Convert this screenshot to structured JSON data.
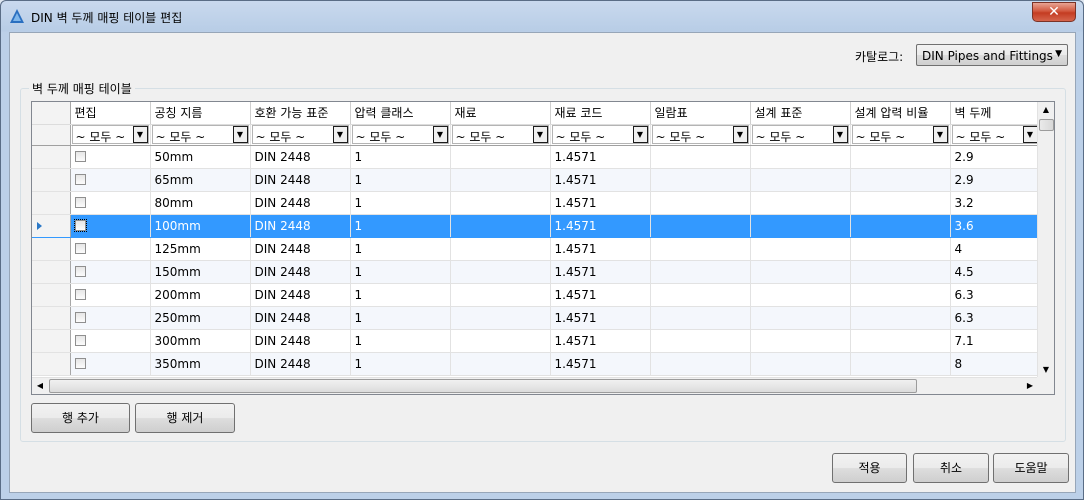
{
  "window": {
    "title": "DIN 벽 두께 매핑 테이블 편집",
    "close_label": "✕"
  },
  "catalog": {
    "label": "카탈로그:",
    "value": "DIN Pipes and Fittings"
  },
  "group": {
    "title": "벽 두께 매핑 테이블"
  },
  "table": {
    "columns": [
      "편집",
      "공칭 지름",
      "호환 가능 표준",
      "압력 클래스",
      "재료",
      "재료 코드",
      "일람표",
      "설계 표준",
      "설계 압력 비율",
      "벽 두께"
    ],
    "filter_value": "~ 모두 ~",
    "rows": [
      {
        "checked": false,
        "size": "50mm",
        "standard": "DIN 2448",
        "pressure": "1",
        "material": "",
        "code": "1.4571",
        "schedule": "",
        "design_std": "",
        "design_ratio": "",
        "wall": "2.9"
      },
      {
        "checked": false,
        "size": "65mm",
        "standard": "DIN 2448",
        "pressure": "1",
        "material": "",
        "code": "1.4571",
        "schedule": "",
        "design_std": "",
        "design_ratio": "",
        "wall": "2.9"
      },
      {
        "checked": false,
        "size": "80mm",
        "standard": "DIN 2448",
        "pressure": "1",
        "material": "",
        "code": "1.4571",
        "schedule": "",
        "design_std": "",
        "design_ratio": "",
        "wall": "3.2"
      },
      {
        "checked": false,
        "size": "100mm",
        "standard": "DIN 2448",
        "pressure": "1",
        "material": "",
        "code": "1.4571",
        "schedule": "",
        "design_std": "",
        "design_ratio": "",
        "wall": "3.6",
        "selected": true
      },
      {
        "checked": false,
        "size": "125mm",
        "standard": "DIN 2448",
        "pressure": "1",
        "material": "",
        "code": "1.4571",
        "schedule": "",
        "design_std": "",
        "design_ratio": "",
        "wall": "4"
      },
      {
        "checked": false,
        "size": "150mm",
        "standard": "DIN 2448",
        "pressure": "1",
        "material": "",
        "code": "1.4571",
        "schedule": "",
        "design_std": "",
        "design_ratio": "",
        "wall": "4.5"
      },
      {
        "checked": false,
        "size": "200mm",
        "standard": "DIN 2448",
        "pressure": "1",
        "material": "",
        "code": "1.4571",
        "schedule": "",
        "design_std": "",
        "design_ratio": "",
        "wall": "6.3"
      },
      {
        "checked": false,
        "size": "250mm",
        "standard": "DIN 2448",
        "pressure": "1",
        "material": "",
        "code": "1.4571",
        "schedule": "",
        "design_std": "",
        "design_ratio": "",
        "wall": "6.3"
      },
      {
        "checked": false,
        "size": "300mm",
        "standard": "DIN 2448",
        "pressure": "1",
        "material": "",
        "code": "1.4571",
        "schedule": "",
        "design_std": "",
        "design_ratio": "",
        "wall": "7.1"
      },
      {
        "checked": false,
        "size": "350mm",
        "standard": "DIN 2448",
        "pressure": "1",
        "material": "",
        "code": "1.4571",
        "schedule": "",
        "design_std": "",
        "design_ratio": "",
        "wall": "8"
      }
    ]
  },
  "buttons": {
    "add_row": "행 추가",
    "remove_row": "행 제거",
    "apply": "적용",
    "cancel": "취소",
    "help": "도움말"
  },
  "icons": {
    "app": "autocad-plant-icon",
    "dropdown": "triangle-down-icon",
    "selected_row": "row-pointer-icon"
  },
  "colors": {
    "selection": "#3399ff",
    "close": "#c43c22"
  }
}
